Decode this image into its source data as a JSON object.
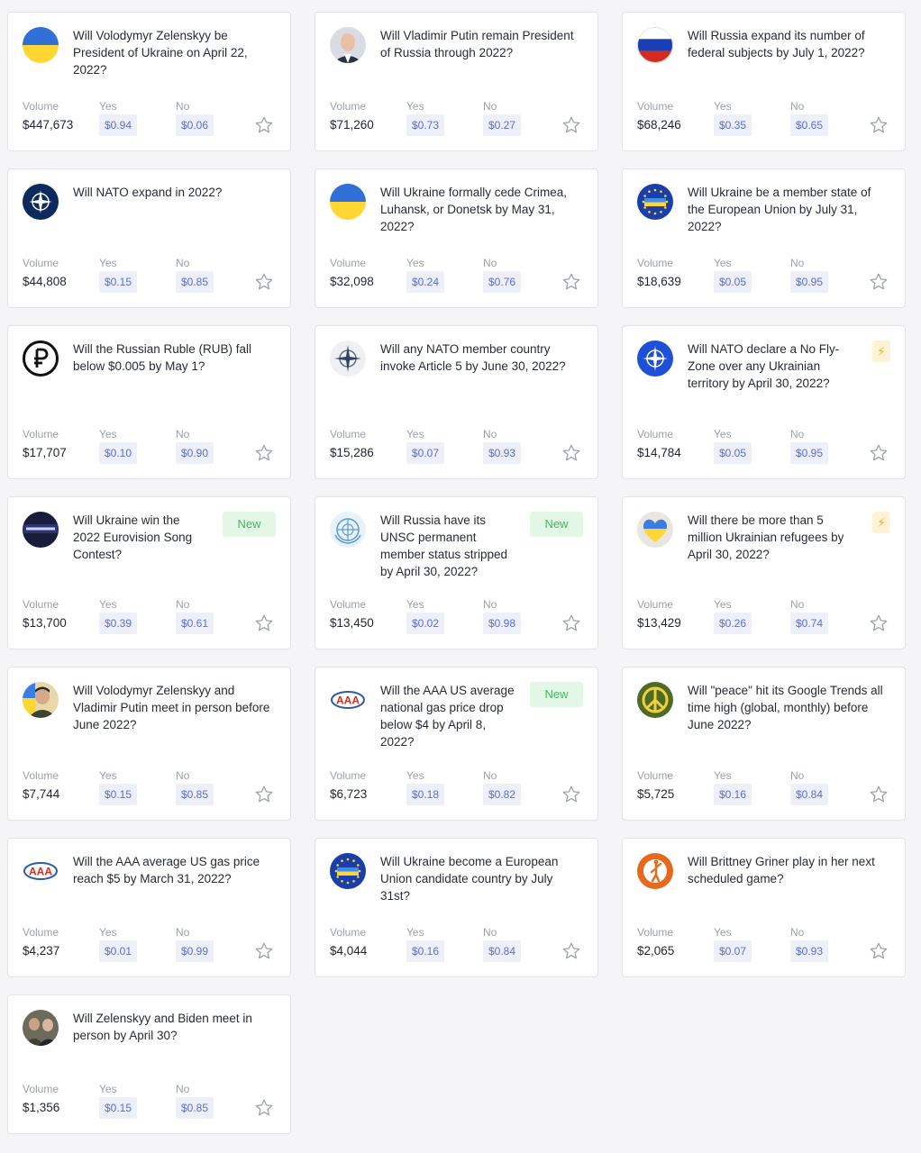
{
  "labels": {
    "volume": "Volume",
    "yes": "Yes",
    "no": "No",
    "new": "New"
  },
  "cards": [
    {
      "title": "Will Volodymyr Zelenskyy be President of Ukraine on April 22, 2022?",
      "volume": "$447,673",
      "yes": "$0.94",
      "no": "$0.06",
      "icon": "ukraine-flag-icon",
      "badge": ""
    },
    {
      "title": "Will Vladimir Putin remain President of Russia through 2022?",
      "volume": "$71,260",
      "yes": "$0.73",
      "no": "$0.27",
      "icon": "putin-portrait-icon",
      "badge": ""
    },
    {
      "title": "Will Russia expand its number of federal subjects by July 1, 2022?",
      "volume": "$68,246",
      "yes": "$0.35",
      "no": "$0.65",
      "icon": "russia-flag-icon",
      "badge": ""
    },
    {
      "title": "Will NATO expand in 2022?",
      "volume": "$44,808",
      "yes": "$0.15",
      "no": "$0.85",
      "icon": "nato-logo-icon",
      "badge": ""
    },
    {
      "title": "Will Ukraine formally cede Crimea, Luhansk, or Donetsk by May 31, 2022?",
      "volume": "$32,098",
      "yes": "$0.24",
      "no": "$0.76",
      "icon": "ukraine-flag-icon",
      "badge": ""
    },
    {
      "title": "Will Ukraine be a member state of the European Union by July 31, 2022?",
      "volume": "$18,639",
      "yes": "$0.05",
      "no": "$0.95",
      "icon": "eu-ukraine-flag-icon",
      "badge": ""
    },
    {
      "title": "Will the Russian Ruble (RUB) fall below $0.005 by May 1?",
      "volume": "$17,707",
      "yes": "$0.10",
      "no": "$0.90",
      "icon": "ruble-icon",
      "badge": ""
    },
    {
      "title": "Will any NATO member country invoke Article 5 by June 30, 2022?",
      "volume": "$15,286",
      "yes": "$0.07",
      "no": "$0.93",
      "icon": "nato-compass-icon",
      "badge": ""
    },
    {
      "title": "Will NATO declare a No Fly-Zone over any Ukrainian territory by April 30, 2022?",
      "volume": "$14,784",
      "yes": "$0.05",
      "no": "$0.95",
      "icon": "nato-blue-logo-icon",
      "badge": "bolt"
    },
    {
      "title": "Will Ukraine win the 2022 Eurovision Song Contest?",
      "volume": "$13,700",
      "yes": "$0.39",
      "no": "$0.61",
      "icon": "eurovision-logo-icon",
      "badge": "new"
    },
    {
      "title": "Will Russia have its UNSC permanent member status stripped by April 30, 2022?",
      "volume": "$13,450",
      "yes": "$0.02",
      "no": "$0.98",
      "icon": "un-logo-icon",
      "badge": "new"
    },
    {
      "title": "Will there be more than 5 million Ukrainian refugees by April 30, 2022?",
      "volume": "$13,429",
      "yes": "$0.26",
      "no": "$0.74",
      "icon": "ukraine-heart-icon",
      "badge": "bolt"
    },
    {
      "title": "Will Volodymyr Zelenskyy and Vladimir Putin meet in person before June 2022?",
      "volume": "$7,744",
      "yes": "$0.15",
      "no": "$0.85",
      "icon": "zelenskyy-portrait-icon",
      "badge": ""
    },
    {
      "title": "Will the AAA US average national gas price drop below $4 by April 8, 2022?",
      "volume": "$6,723",
      "yes": "$0.18",
      "no": "$0.82",
      "icon": "aaa-logo-icon",
      "badge": "new"
    },
    {
      "title": "Will \"peace\" hit its Google Trends all time high (global, monthly) before June 2022?",
      "volume": "$5,725",
      "yes": "$0.16",
      "no": "$0.84",
      "icon": "peace-sign-icon",
      "badge": ""
    },
    {
      "title": "Will the AAA average US gas price reach $5 by March 31, 2022?",
      "volume": "$4,237",
      "yes": "$0.01",
      "no": "$0.99",
      "icon": "aaa-logo-icon",
      "badge": ""
    },
    {
      "title": "Will Ukraine become a European Union candidate country by July 31st?",
      "volume": "$4,044",
      "yes": "$0.16",
      "no": "$0.84",
      "icon": "eu-ukraine-flag-icon",
      "badge": ""
    },
    {
      "title": "Will Brittney Griner play in her next scheduled game?",
      "volume": "$2,065",
      "yes": "$0.07",
      "no": "$0.93",
      "icon": "basketball-player-icon",
      "badge": ""
    },
    {
      "title": "Will Zelenskyy and Biden meet in person by April 30?",
      "volume": "$1,356",
      "yes": "$0.15",
      "no": "$0.85",
      "icon": "zelenskyy-biden-photo-icon",
      "badge": ""
    }
  ],
  "colors": {
    "accent": "#5b6dd6",
    "price_bg": "#eef0f9",
    "new_bg": "#e3f7e6",
    "new_text": "#46b65c",
    "bolt": "#f5b400"
  }
}
